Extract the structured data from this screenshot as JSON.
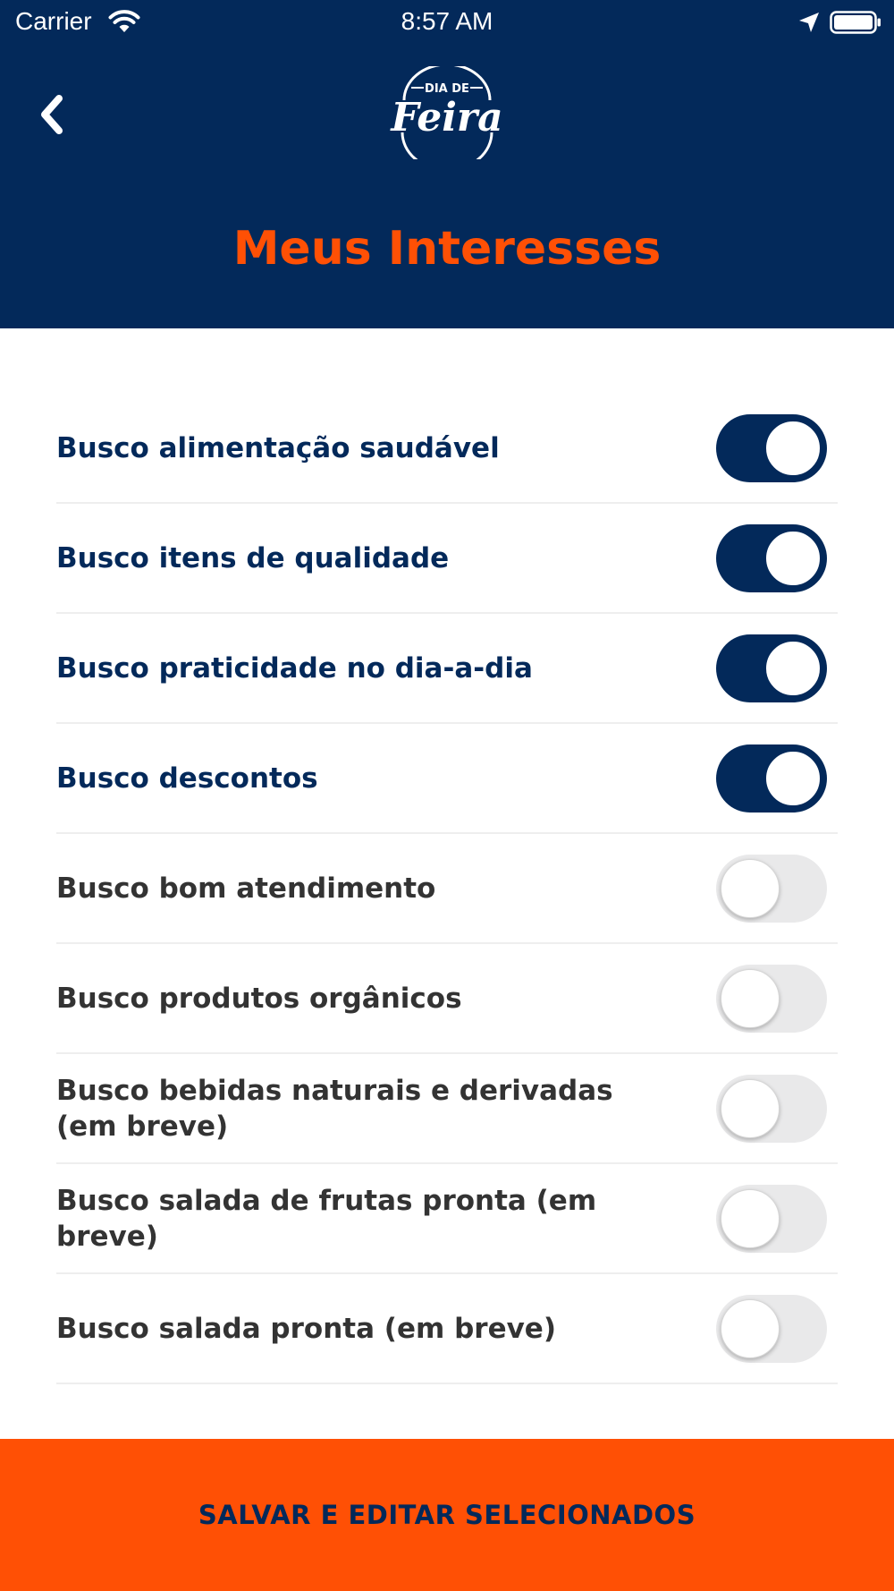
{
  "status_bar": {
    "carrier": "Carrier",
    "time": "8:57 AM"
  },
  "header": {
    "logo_text_top": "DIA DE",
    "logo_text_main": "Feira",
    "title": "Meus Interesses"
  },
  "interests": [
    {
      "label": "Busco alimentação saudável",
      "enabled": true
    },
    {
      "label": "Busco itens de qualidade",
      "enabled": true
    },
    {
      "label": "Busco praticidade no dia-a-dia",
      "enabled": true
    },
    {
      "label": "Busco descontos",
      "enabled": true
    },
    {
      "label": "Busco bom atendimento",
      "enabled": false
    },
    {
      "label": "Busco produtos orgânicos",
      "enabled": false
    },
    {
      "label": "Busco bebidas naturais e derivadas (em breve)",
      "enabled": false
    },
    {
      "label": "Busco salada de frutas pronta (em breve)",
      "enabled": false
    },
    {
      "label": "Busco salada pronta (em breve)",
      "enabled": false
    }
  ],
  "footer": {
    "save_label": "SALVAR E EDITAR SELECIONADOS"
  },
  "colors": {
    "navy": "#03295a",
    "orange": "#ff5005",
    "toggle_off": "#e9e9ea"
  },
  "icons": {
    "back": "chevron-left-icon",
    "wifi": "wifi-icon",
    "location": "location-arrow-icon",
    "battery": "battery-icon"
  }
}
